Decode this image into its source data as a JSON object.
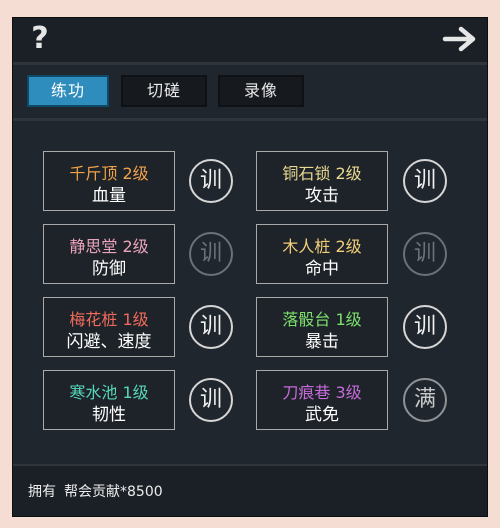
{
  "header": {
    "help_label": "?"
  },
  "tabs": [
    {
      "label": "练功",
      "active": true
    },
    {
      "label": "切磋",
      "active": false
    },
    {
      "label": "录像",
      "active": false
    }
  ],
  "train_label": "训",
  "max_label": "满",
  "skills": [
    {
      "name": "千斤顶 2级",
      "attr": "血量",
      "name_color": "#f0a14a",
      "button": "train"
    },
    {
      "name": "铜石锁 2级",
      "attr": "攻击",
      "name_color": "#e9d98f",
      "button": "train"
    },
    {
      "name": "静思堂 2级",
      "attr": "防御",
      "name_color": "#eaa3bb",
      "button": "disabled"
    },
    {
      "name": "木人桩 2级",
      "attr": "命中",
      "name_color": "#f1ce7a",
      "button": "disabled"
    },
    {
      "name": "梅花桩 1级",
      "attr": "闪避、速度",
      "name_color": "#f06a5a",
      "button": "train"
    },
    {
      "name": "落骰台 1级",
      "attr": "暴击",
      "name_color": "#7be06b",
      "button": "train"
    },
    {
      "name": "寒水池 1级",
      "attr": "韧性",
      "name_color": "#58d6b9",
      "button": "train"
    },
    {
      "name": "刀痕巷 3级",
      "attr": "武免",
      "name_color": "#c36bd8",
      "button": "max"
    }
  ],
  "footer": {
    "label": "拥有",
    "contribution": "帮会贡献*8500"
  }
}
